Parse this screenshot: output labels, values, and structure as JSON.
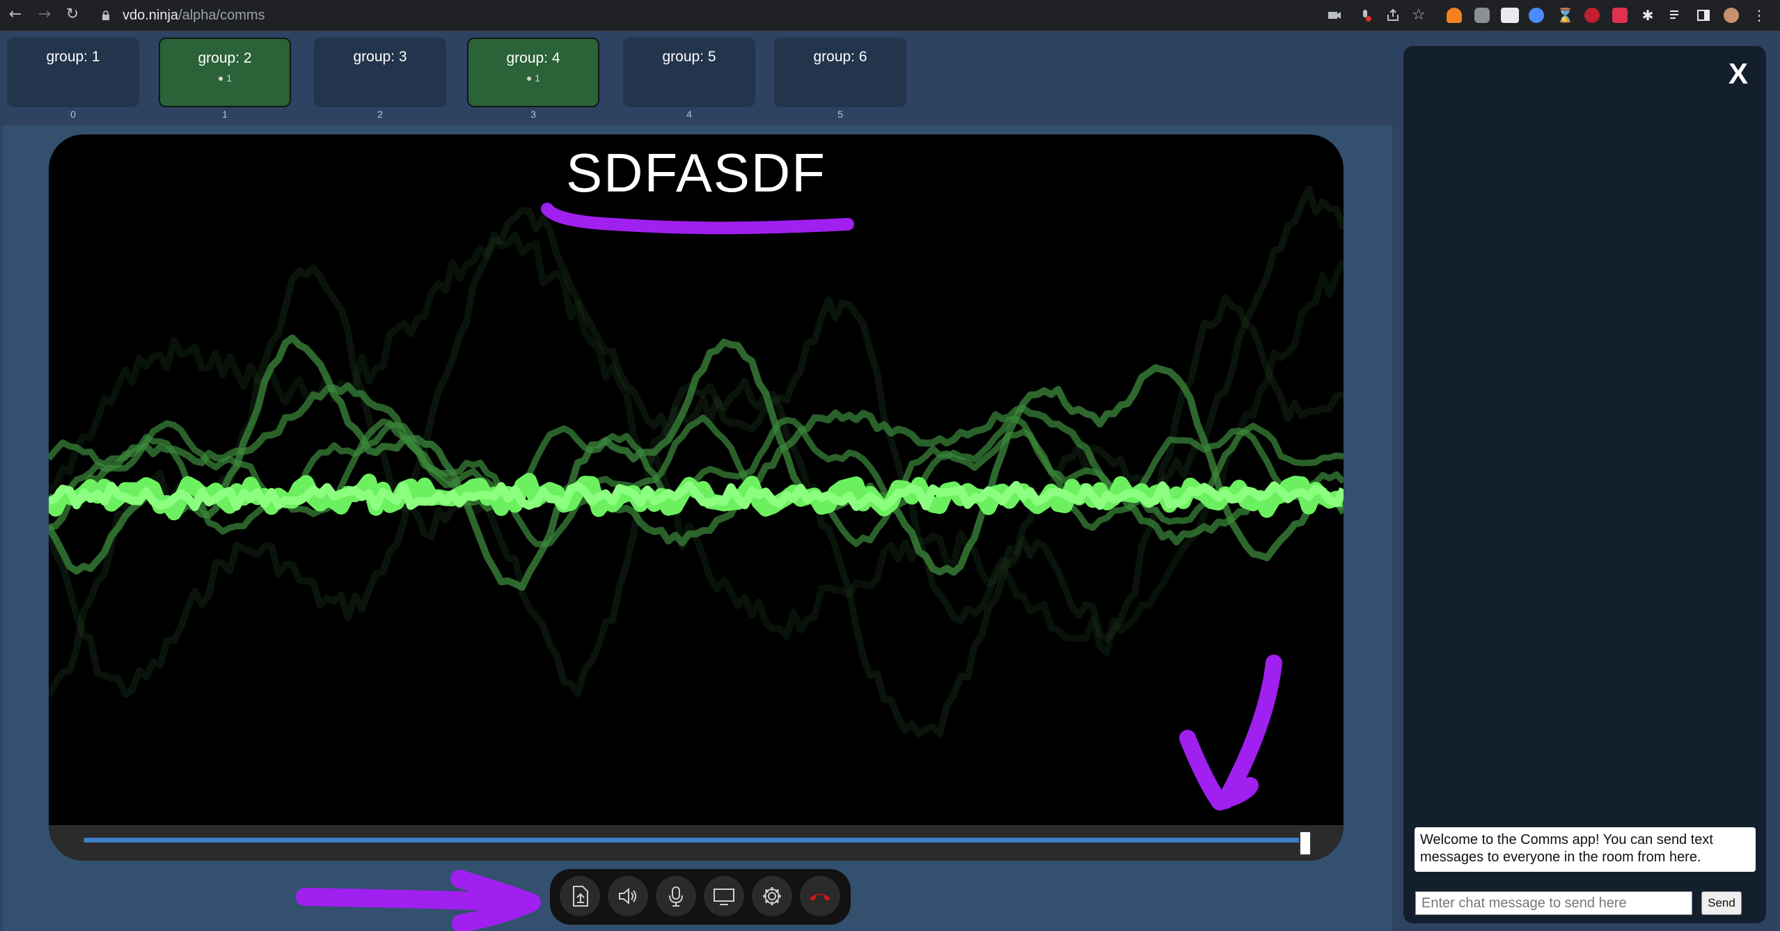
{
  "browser": {
    "url_host": "vdo.ninja",
    "url_path": "/alpha/comms"
  },
  "groups": [
    {
      "label": "group: 1",
      "count": "",
      "index": "0",
      "active": false
    },
    {
      "label": "group: 2",
      "count": "1",
      "index": "1",
      "active": true
    },
    {
      "label": "group: 3",
      "count": "",
      "index": "2",
      "active": false
    },
    {
      "label": "group: 4",
      "count": "1",
      "index": "3",
      "active": true
    },
    {
      "label": "group: 5",
      "count": "",
      "index": "4",
      "active": false
    },
    {
      "label": "group: 6",
      "count": "",
      "index": "5",
      "active": false
    }
  ],
  "stream": {
    "title": "SDFASDF",
    "volume_level": 1.0
  },
  "controls": {
    "icons": [
      "file-share-icon",
      "speaker-icon",
      "microphone-icon",
      "screen-share-icon",
      "settings-gear-icon",
      "hangup-icon"
    ]
  },
  "chat": {
    "close_label": "X",
    "welcome_message": "Welcome to the Comms app! You can send text messages to everyone in the room from here.",
    "input_placeholder": "Enter chat message to send here",
    "send_label": "Send"
  },
  "colors": {
    "page_bg": "#2e4361",
    "active_group": "#2b6238",
    "wave_bright": "#6cf060",
    "annotation": "#a020f0",
    "hangup": "#d01818"
  }
}
